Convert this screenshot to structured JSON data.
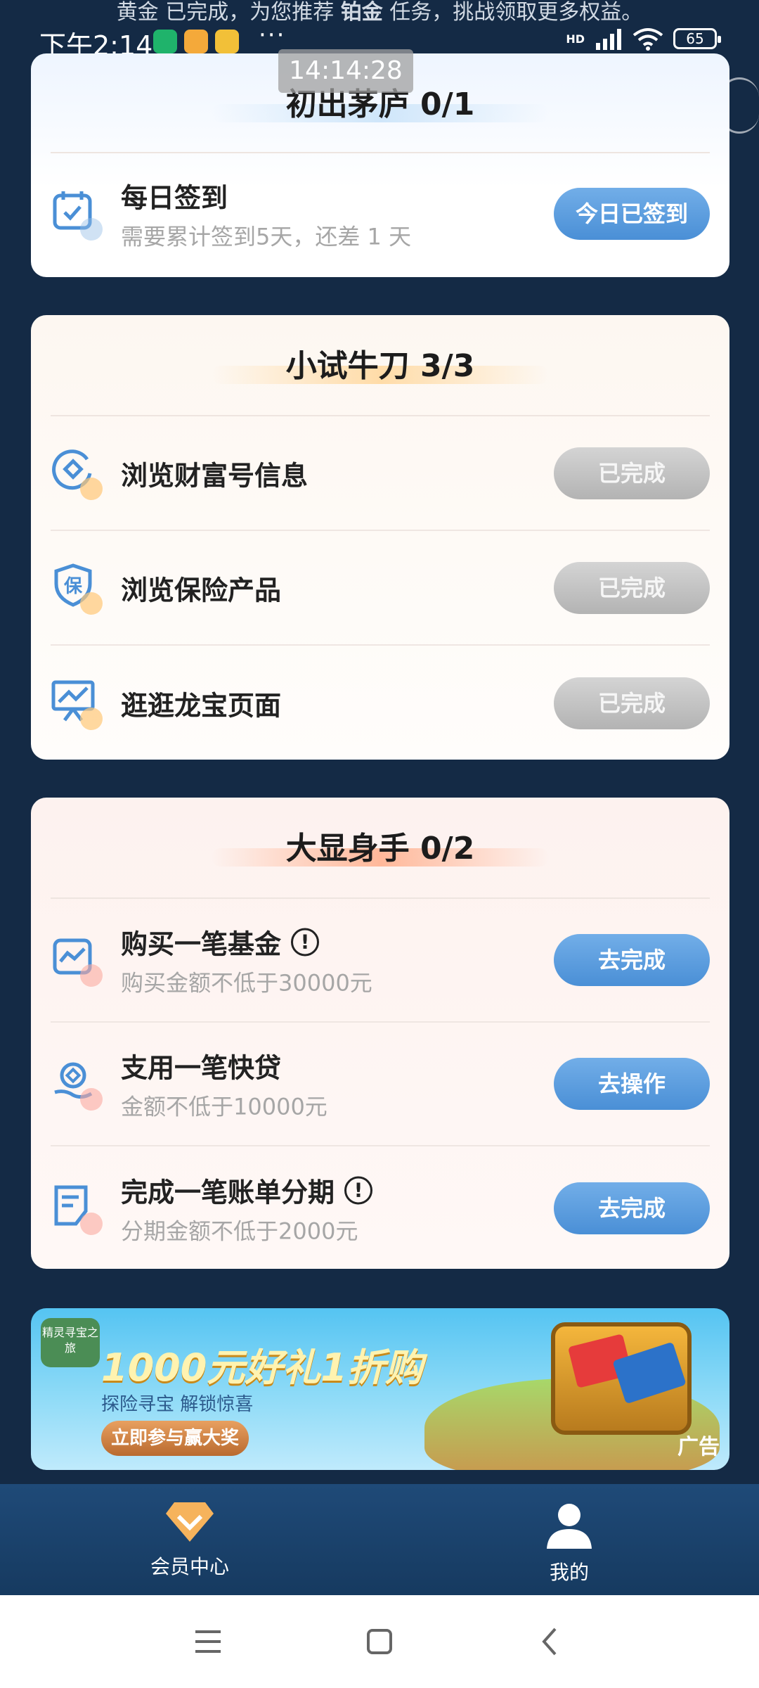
{
  "top_banner": {
    "prefix": "黄金 已完成，为您推荐 ",
    "highlight": "铂金",
    "suffix": " 任务，挑战领取更多权益。"
  },
  "status_bar": {
    "time": "下午2:14",
    "network": "HD",
    "battery": "65"
  },
  "screenshot_timestamp": "14:14:28",
  "card_novice": {
    "title": "初出茅庐 0/1",
    "tasks": [
      {
        "title": "每日签到",
        "subtitle": "需要累计签到5天，还差 1 天",
        "button": "今日已签到",
        "icon": "calendar-check-icon"
      }
    ]
  },
  "card_trial": {
    "title": "小试牛刀 3/3",
    "tasks": [
      {
        "title": "浏览财富号信息",
        "button": "已完成",
        "icon": "wealth-icon"
      },
      {
        "title": "浏览保险产品",
        "button": "已完成",
        "icon": "insurance-shield-icon",
        "icon_text": "保"
      },
      {
        "title": "逛逛龙宝页面",
        "button": "已完成",
        "icon": "presentation-icon"
      }
    ]
  },
  "card_expert": {
    "title": "大显身手 0/2",
    "tasks": [
      {
        "title": "购买一笔基金",
        "subtitle": "购买金额不低于30000元",
        "button": "去完成",
        "icon": "fund-chart-icon",
        "info": "!"
      },
      {
        "title": "支用一笔快贷",
        "subtitle": "金额不低于10000元",
        "button": "去操作",
        "icon": "loan-icon"
      },
      {
        "title": "完成一笔账单分期",
        "subtitle": "分期金额不低于2000元",
        "button": "去完成",
        "icon": "bill-installment-icon",
        "info": "!"
      }
    ]
  },
  "ad": {
    "logo_text": "精灵寻宝之旅",
    "headline": "1000元好礼1折购",
    "sub": "探险寻宝 解锁惊喜",
    "cta": "立即参与赢大奖",
    "tag": "广告"
  },
  "bottom_nav": {
    "items": [
      {
        "label": "会员中心",
        "icon": "diamond-icon"
      },
      {
        "label": "我的",
        "icon": "user-icon"
      }
    ]
  },
  "colors": {
    "background": "#142a45",
    "primary_button": "#5a9de0",
    "done_button": "#bdbdbd",
    "nav_bar": "#1b4470"
  }
}
